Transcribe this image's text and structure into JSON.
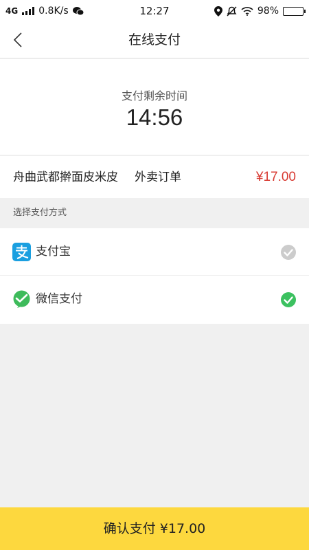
{
  "status_bar": {
    "network": "4G",
    "speed": "0.8K/s",
    "time": "12:27",
    "battery": "98%",
    "battery_level": 0.98
  },
  "nav": {
    "title": "在线支付",
    "back_icon": "chevron-left-icon"
  },
  "timer": {
    "label": "支付剩余时间",
    "value": "14:56"
  },
  "order": {
    "name": "舟曲武都擀面皮米皮",
    "type": "外卖订单",
    "price": "¥17.00"
  },
  "payment": {
    "section_label": "选择支付方式",
    "methods": [
      {
        "label": "支付宝",
        "icon": "alipay-icon",
        "selected": false,
        "icon_color": "#1a9fe0"
      },
      {
        "label": "微信支付",
        "icon": "wechat-pay-icon",
        "selected": true,
        "icon_color": "#3ebb5b"
      }
    ]
  },
  "confirm": {
    "label": "确认支付 ¥17.00"
  },
  "colors": {
    "accent": "#fdd83e",
    "price": "#d83a32",
    "check_selected": "#3cc160",
    "check_unselected": "#cccccc"
  }
}
